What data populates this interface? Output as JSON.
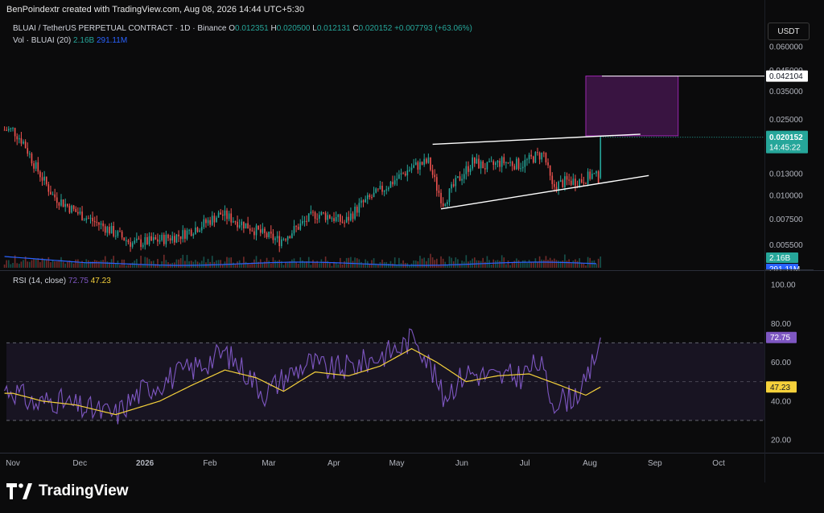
{
  "header": {
    "author_line": "BenPoindextr created with TradingView.com, Aug 08, 2026 14:44 UTC+5:30"
  },
  "symbol": {
    "name": "BLUAI / TetherUS PERPETUAL CONTRACT · 1D · Binance",
    "o_label": "O",
    "o": "0.012351",
    "h_label": "H",
    "h": "0.020500",
    "l_label": "L",
    "l": "0.012131",
    "c_label": "C",
    "c": "0.020152",
    "change": "+0.007793 (+63.06%)"
  },
  "volume_legend": {
    "label": "Vol · BLUAI (20)",
    "vol": "2.16B",
    "ma": "291.11M"
  },
  "rsi_legend": {
    "label": "RSI (14, close)",
    "rsi": "72.75",
    "ma": "47.23"
  },
  "currency": "USDT",
  "brand": {
    "name": "TradingView"
  },
  "colors": {
    "up": "#26a69a",
    "down": "#ef5350",
    "vol_ma": "#2962ff",
    "rsi": "#7e57c2",
    "rsi_ma": "#f5d13b",
    "box": "#9c27b0"
  },
  "chart_data": [
    {
      "type": "candlestick",
      "title": "",
      "x_ticks": [
        "Nov",
        "Dec",
        "2026",
        "Feb",
        "Mar",
        "Apr",
        "May",
        "Jun",
        "Jul",
        "Aug",
        "Sep",
        "Oct"
      ],
      "y_scale": "log",
      "y_ticks": [
        "0.060000",
        "0.045000",
        "0.035000",
        "0.025000",
        "0.020152",
        "0.013000",
        "0.010000",
        "0.007500",
        "0.005500"
      ],
      "price_labels": {
        "box_top": "0.042104",
        "last": "0.020152",
        "countdown": "14:45:22"
      },
      "last_close": 0.020152,
      "channel": {
        "upper": [
          [
            "May 20",
            0.0185
          ],
          [
            "Aug 27",
            0.0209
          ]
        ],
        "lower": [
          [
            "May 24",
            0.0085
          ],
          [
            "Aug 31",
            0.0127
          ]
        ]
      },
      "projection_box": {
        "x_start": "Aug 01",
        "x_end": "Sep 14",
        "y_top": 0.042104,
        "y_bottom": 0.0205
      },
      "price_path": [
        [
          "Nov 01",
          0.022
        ],
        [
          "Nov 06",
          0.019
        ],
        [
          "Nov 12",
          0.014
        ],
        [
          "Nov 20",
          0.01
        ],
        [
          "Dec 01",
          0.0082
        ],
        [
          "Dec 15",
          0.0068
        ],
        [
          "Dec 28",
          0.0056
        ],
        [
          "Jan 08",
          0.0058
        ],
        [
          "Jan 20",
          0.0062
        ],
        [
          "Feb 01",
          0.0072
        ],
        [
          "Feb 08",
          0.008
        ],
        [
          "Feb 20",
          0.007
        ],
        [
          "Mar 01",
          0.0062
        ],
        [
          "Mar 08",
          0.0058
        ],
        [
          "Mar 15",
          0.0066
        ],
        [
          "Mar 25",
          0.008
        ],
        [
          "Apr 01",
          0.0078
        ],
        [
          "Apr 08",
          0.0072
        ],
        [
          "Apr 15",
          0.0088
        ],
        [
          "Apr 22",
          0.01
        ],
        [
          "May 01",
          0.0118
        ],
        [
          "May 10",
          0.014
        ],
        [
          "May 18",
          0.015
        ],
        [
          "May 22",
          0.011
        ],
        [
          "May 25",
          0.0092
        ],
        [
          "Jun 01",
          0.012
        ],
        [
          "Jun 08",
          0.015
        ],
        [
          "Jun 15",
          0.014
        ],
        [
          "Jun 22",
          0.015
        ],
        [
          "Jul 01",
          0.0145
        ],
        [
          "Jul 08",
          0.016
        ],
        [
          "Jul 12",
          0.0165
        ],
        [
          "Jul 16",
          0.011
        ],
        [
          "Jul 22",
          0.0118
        ],
        [
          "Jul 30",
          0.012
        ],
        [
          "Aug 04",
          0.0128
        ],
        [
          "Aug 07",
          0.0124
        ],
        [
          "Aug 08",
          0.020152
        ]
      ]
    },
    {
      "type": "bar",
      "title": "",
      "series": [
        {
          "values": []
        }
      ],
      "last_label": "2.16B",
      "ma_label": "291.11M"
    },
    {
      "type": "line",
      "title": "",
      "y_ticks": [
        "100.00",
        "80.00",
        "60.00",
        "40.00",
        "20.00"
      ],
      "levels": [
        70,
        50,
        30
      ],
      "ylim": [
        14,
        100
      ],
      "current_rsi": 72.75,
      "current_ma": 47.23,
      "rsi_path": [
        [
          "Nov 01",
          46
        ],
        [
          "Nov 06",
          42
        ],
        [
          "Nov 12",
          38
        ],
        [
          "Nov 20",
          41
        ],
        [
          "Dec 01",
          37
        ],
        [
          "Dec 10",
          35
        ],
        [
          "Dec 20",
          33
        ],
        [
          "Jan 01",
          45
        ],
        [
          "Jan 15",
          52
        ],
        [
          "Jan 28",
          58
        ],
        [
          "Feb 10",
          65
        ],
        [
          "Feb 20",
          55
        ],
        [
          "Mar 01",
          44
        ],
        [
          "Mar 10",
          52
        ],
        [
          "Mar 22",
          60
        ],
        [
          "Apr 01",
          56
        ],
        [
          "Apr 12",
          58
        ],
        [
          "Apr 22",
          62
        ],
        [
          "May 05",
          68
        ],
        [
          "May 12",
          74
        ],
        [
          "May 20",
          55
        ],
        [
          "May 25",
          42
        ],
        [
          "Jun 05",
          55
        ],
        [
          "Jun 20",
          52
        ],
        [
          "Jul 01",
          53
        ],
        [
          "Jul 10",
          60
        ],
        [
          "Jul 16",
          40
        ],
        [
          "Jul 25",
          42
        ],
        [
          "Aug 01",
          48
        ],
        [
          "Aug 08",
          72.75
        ]
      ],
      "ma_path": [
        [
          "Nov 01",
          44
        ],
        [
          "Nov 15",
          40
        ],
        [
          "Dec 01",
          38
        ],
        [
          "Dec 20",
          33
        ],
        [
          "Jan 10",
          40
        ],
        [
          "Jan 25",
          48
        ],
        [
          "Feb 10",
          56
        ],
        [
          "Feb 25",
          52
        ],
        [
          "Mar 10",
          45
        ],
        [
          "Mar 25",
          55
        ],
        [
          "Apr 10",
          53
        ],
        [
          "Apr 25",
          58
        ],
        [
          "May 10",
          67
        ],
        [
          "May 22",
          60
        ],
        [
          "Jun 05",
          50
        ],
        [
          "Jun 20",
          53
        ],
        [
          "Jul 05",
          54
        ],
        [
          "Jul 20",
          48
        ],
        [
          "Aug 01",
          43
        ],
        [
          "Aug 08",
          47.23
        ]
      ]
    }
  ]
}
